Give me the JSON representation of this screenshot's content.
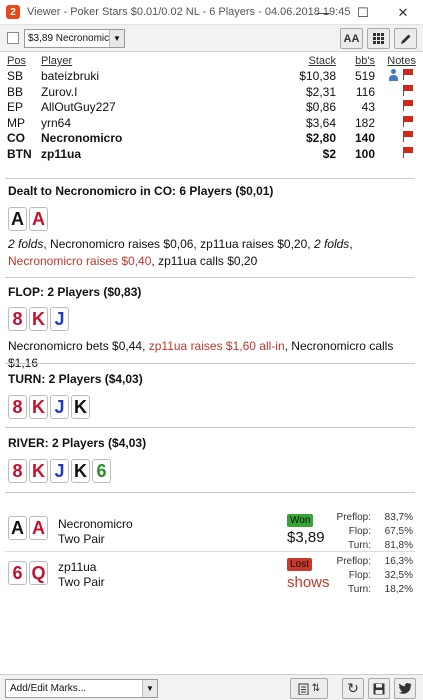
{
  "window": {
    "app_icon": "2",
    "title": "Viewer - Poker Stars $0.01/0.02 NL - 6 Players - 04.06.2018 19:45",
    "minimize": "—",
    "maximize": "☐",
    "close": "✕"
  },
  "toolbar": {
    "player_select_value": "$3,89 Necronomic",
    "font_button": "AA",
    "grid_icon": "grid-icon",
    "edit_icon": "pencil-icon"
  },
  "players_table": {
    "headers": {
      "pos": "Pos",
      "player": "Player",
      "stack": "Stack",
      "bbs": "bb's",
      "notes": "Notes"
    },
    "rows": [
      {
        "pos": "SB",
        "player": "bateizbruki",
        "stack": "$10,38",
        "bbs": "519",
        "bold": false,
        "note_person": true
      },
      {
        "pos": "BB",
        "player": "Zurov.I",
        "stack": "$2,31",
        "bbs": "116",
        "bold": false,
        "note_person": false
      },
      {
        "pos": "EP",
        "player": "AllOutGuy227",
        "stack": "$0,86",
        "bbs": "43",
        "bold": false,
        "note_person": false
      },
      {
        "pos": "MP",
        "player": "yrn64",
        "stack": "$3,64",
        "bbs": "182",
        "bold": false,
        "note_person": false
      },
      {
        "pos": "CO",
        "player": "Necronomicro",
        "stack": "$2,80",
        "bbs": "140",
        "bold": true,
        "note_person": false
      },
      {
        "pos": "BTN",
        "player": "zp11ua",
        "stack": "$2",
        "bbs": "100",
        "bold": true,
        "note_person": false
      }
    ]
  },
  "preflop": {
    "title": "Dealt to Necronomicro in CO: 6 Players ($0,01)",
    "cards": [
      {
        "rank": "A",
        "suit": "spade"
      },
      {
        "rank": "A",
        "suit": "heart"
      }
    ],
    "action_1": "2 folds",
    "action_2": ", Necronomicro raises $0,06, zp11ua raises $0,20, ",
    "action_3": "2 folds",
    "action_4": ", ",
    "action_5": "Necronomicro raises $0,40",
    "action_6": ", zp11ua calls $0,20"
  },
  "flop": {
    "title": "FLOP: 2 Players ($0,83)",
    "cards": [
      {
        "rank": "8",
        "suit": "heart"
      },
      {
        "rank": "K",
        "suit": "heart"
      },
      {
        "rank": "J",
        "suit": "diamond"
      }
    ],
    "action_1": "Necronomicro bets $0,44, ",
    "action_2": "zp11ua raises $1,60 all-in",
    "action_3": ", Necronomicro calls $1,16"
  },
  "turn": {
    "title": "TURN: 2 Players ($4,03)",
    "cards": [
      {
        "rank": "8",
        "suit": "heart"
      },
      {
        "rank": "K",
        "suit": "heart"
      },
      {
        "rank": "J",
        "suit": "diamond"
      },
      {
        "rank": "K",
        "suit": "spade"
      }
    ]
  },
  "river": {
    "title": "RIVER: 2 Players ($4,03)",
    "cards": [
      {
        "rank": "8",
        "suit": "heart"
      },
      {
        "rank": "K",
        "suit": "heart"
      },
      {
        "rank": "J",
        "suit": "diamond"
      },
      {
        "rank": "K",
        "suit": "spade"
      },
      {
        "rank": "6",
        "suit": "club"
      }
    ]
  },
  "results": [
    {
      "cards": [
        {
          "rank": "A",
          "suit": "spade"
        },
        {
          "rank": "A",
          "suit": "heart"
        }
      ],
      "name": "Necronomicro",
      "hand": "Two Pair",
      "badge": "Won",
      "amount": "$3,89",
      "eq_labels": [
        "Preflop:",
        "Flop:",
        "Turn:"
      ],
      "eq_values": [
        "83,7%",
        "67,5%",
        "81,8%"
      ]
    },
    {
      "cards": [
        {
          "rank": "6",
          "suit": "heart"
        },
        {
          "rank": "Q",
          "suit": "heart"
        }
      ],
      "name": "zp11ua",
      "hand": "Two Pair",
      "badge": "Lost",
      "amount": "shows",
      "eq_labels": [
        "Preflop:",
        "Flop:",
        "Turn:"
      ],
      "eq_values": [
        "16,3%",
        "32,5%",
        "18,2%"
      ]
    }
  ],
  "bottom_bar": {
    "marks_select": "Add/Edit Marks...",
    "sort_glyph": "⇅",
    "refresh_glyph": "↻",
    "save_glyph": "💾",
    "twitter_glyph": "🐦"
  }
}
